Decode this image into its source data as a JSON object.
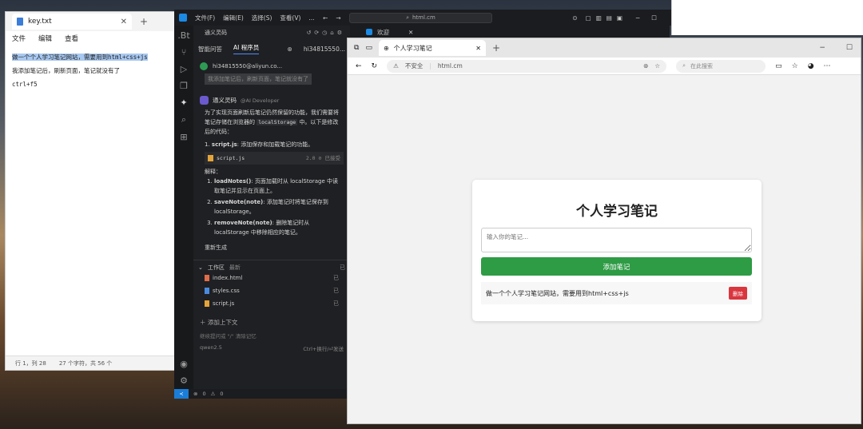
{
  "notepad": {
    "tab_title": "key.txt",
    "menu": [
      "文件",
      "编辑",
      "查看"
    ],
    "lines": [
      "做一个个人学习笔记网站，需要用到html+css+js",
      "我添加笔记后，刷新页面，笔记就没有了",
      "ctrl+f5"
    ],
    "status_position": "行 1，列 28",
    "status_chars": "27 个字符，共 56 个"
  },
  "vscode": {
    "menus": [
      "文件(F)",
      "编辑(E)",
      "选择(S)",
      "查看(V)",
      "..."
    ],
    "search_text": "html.cm",
    "panel_header": "通义灵码",
    "editor_tab": "欢迎",
    "tabs": [
      "智能问答",
      "AI 程序员"
    ],
    "account": "hi34815550...",
    "user_email": "hi34815550@aliyun.co...",
    "user_message": "我添加笔记后，刷新页面，笔记就没有了",
    "ai_name": "通义灵码",
    "ai_role": "@AI Developer",
    "ai_intro_1": "为了实现页面刷新后笔记仍然保留的功能，我们需要将笔记存储在浏览器的",
    "ai_intro_code": "localStorage",
    "ai_intro_2": "中。以下是修改后的代码：",
    "step1_label": "script.js",
    "step1_text": "添加保存和加载笔记的功能。",
    "file_chip_name": "script.js",
    "file_chip_version": "2.0",
    "file_chip_status": "已接受",
    "explain_label": "解释：",
    "explain_items": [
      {
        "name": "loadNotes()",
        "text": "页面加载时从 localStorage 中读取笔记并显示在页面上。"
      },
      {
        "name": "saveNote(note)",
        "text": "添加笔记时将笔记保存到 localStorage。"
      },
      {
        "name": "removeNote(note)",
        "text": "删除笔记时从 localStorage 中移除相应的笔记。"
      }
    ],
    "regen": "重新生成",
    "workspace_title": "工作区",
    "workspace_sub": "最新",
    "workspace_status": "已",
    "workspace_files": [
      "index.html",
      "styles.css",
      "script.js"
    ],
    "add_context": "添加上下文",
    "input_hint": "继续提问或 \"/\" 清除记忆",
    "model": "qwen2.5",
    "shortcut": "Ctrl+换行/⏎发送",
    "status_errors": "0",
    "status_warnings": "0"
  },
  "browser": {
    "tab_title": "个人学习笔记",
    "insecure_label": "不安全",
    "url": "html.cm",
    "search_placeholder": "在此搜索",
    "page": {
      "title": "个人学习笔记",
      "input_placeholder": "输入你的笔记...",
      "add_button": "添加笔记",
      "notes": [
        "做一个个人学习笔记网站，需要用到html+css+js"
      ],
      "delete_button": "删除"
    }
  },
  "colors": {
    "accent_green": "#2e9b45",
    "delete_red": "#d9363e",
    "vscode_blue": "#1a7dd8"
  }
}
